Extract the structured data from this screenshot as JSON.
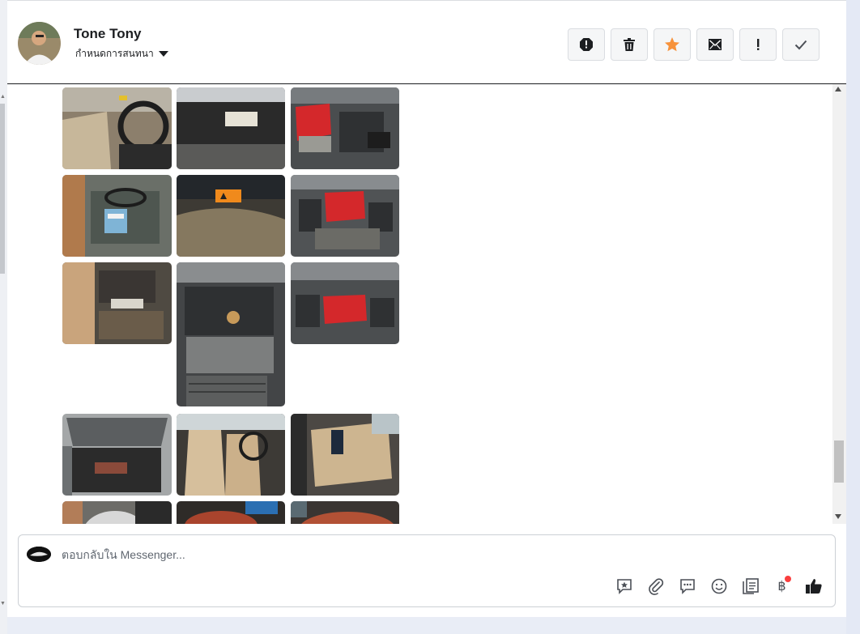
{
  "conversation": {
    "contact_name": "Tone Tony",
    "assign_label": "กำหนดการสนทนา"
  },
  "header_actions": [
    {
      "icon": "block-icon",
      "label": "block"
    },
    {
      "icon": "trash-icon",
      "label": "delete"
    },
    {
      "icon": "star-icon",
      "label": "star",
      "color": "#f7923b"
    },
    {
      "icon": "mark-unread-icon",
      "label": "mark unread"
    },
    {
      "icon": "exclamation-icon",
      "label": "spam"
    },
    {
      "icon": "check-icon",
      "label": "done"
    }
  ],
  "thread_photos": [
    {
      "subject": "car interior driver seat"
    },
    {
      "subject": "trunk lining"
    },
    {
      "subject": "engine bay red cover"
    },
    {
      "subject": "rear seat"
    },
    {
      "subject": "trunk lid sticker"
    },
    {
      "subject": "engine bay red cover"
    },
    {
      "subject": "engine side"
    },
    {
      "subject": "engine top tall"
    },
    {
      "subject": "engine bay red cover"
    },
    {
      "subject": "open trunk"
    },
    {
      "subject": "front seats beige"
    },
    {
      "subject": "rear seats beige"
    },
    {
      "subject": "steering wheel"
    },
    {
      "subject": "dashboard gauge"
    },
    {
      "subject": "gauge cluster"
    }
  ],
  "composer": {
    "placeholder": "ตอบกลับใน Messenger...",
    "tools": [
      "saved-reply-icon",
      "attachment-icon",
      "chat-bubble-icon",
      "emoji-icon",
      "template-icon",
      "baht-payment-icon",
      "like-icon"
    ],
    "payment_symbol": "฿",
    "notification_color": "#fa3e3e"
  }
}
